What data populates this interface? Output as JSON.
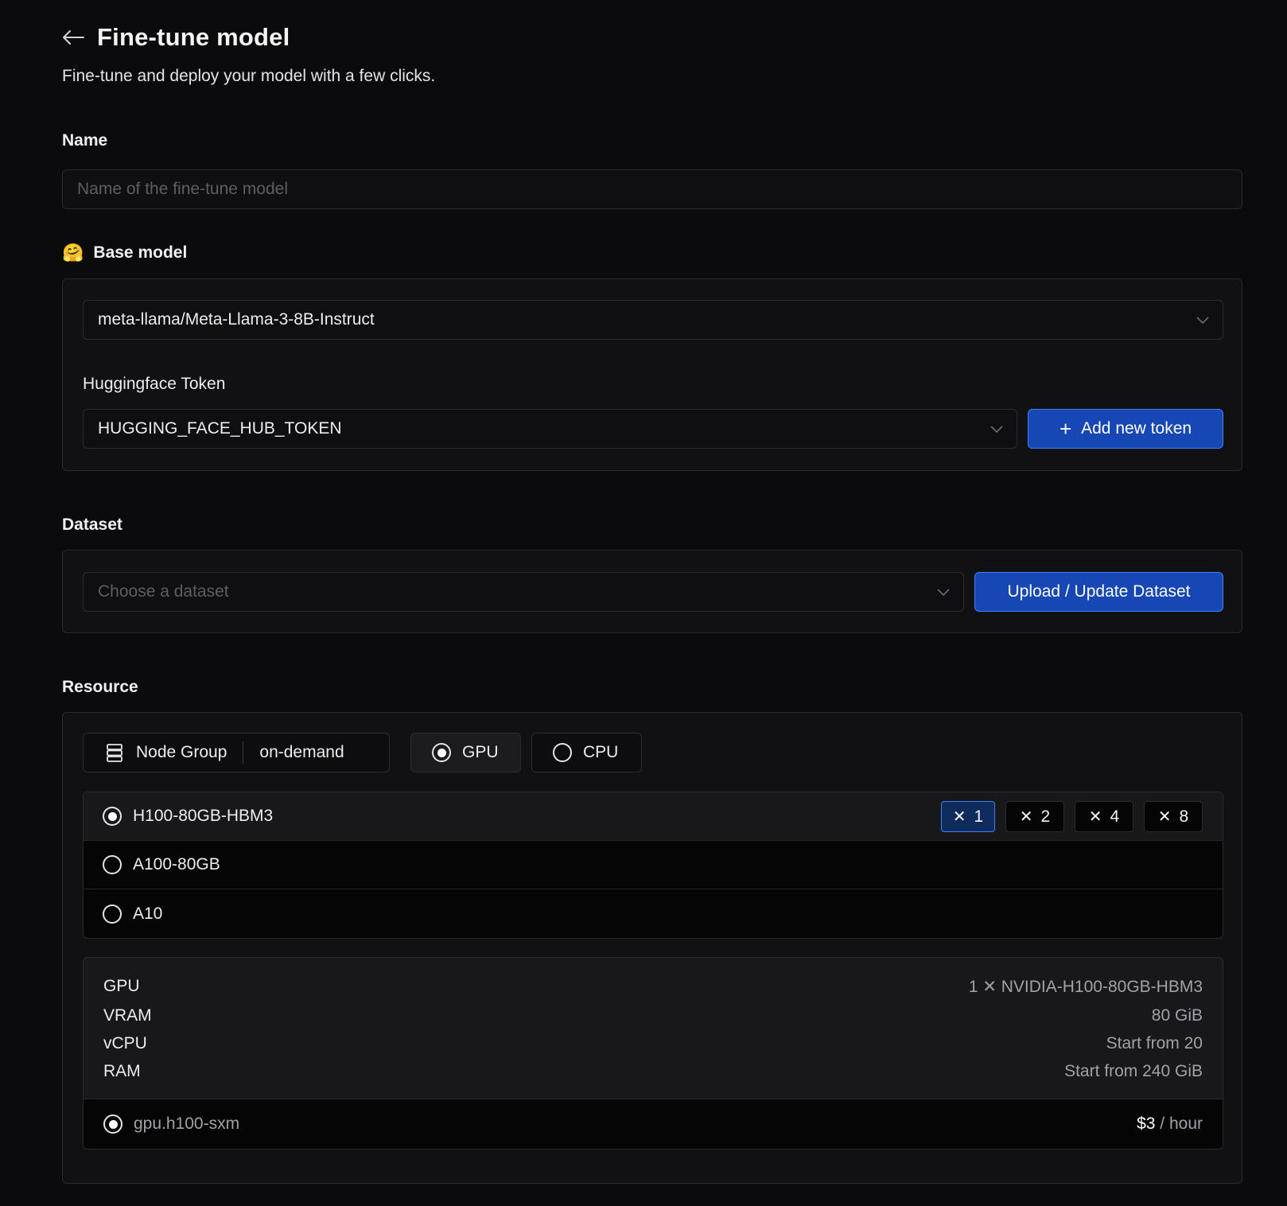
{
  "header": {
    "title": "Fine-tune model",
    "subtitle": "Fine-tune and deploy your model with a few clicks."
  },
  "name_section": {
    "label": "Name",
    "placeholder": "Name of the fine-tune model",
    "value": ""
  },
  "base_model": {
    "emoji": "🤗",
    "label": "Base model",
    "selected_model": "meta-llama/Meta-Llama-3-8B-Instruct",
    "token_label": "Huggingface Token",
    "selected_token": "HUGGING_FACE_HUB_TOKEN",
    "add_token_label": "Add new token"
  },
  "dataset": {
    "label": "Dataset",
    "placeholder": "Choose a dataset",
    "upload_label": "Upload / Update Dataset"
  },
  "resource": {
    "label": "Resource",
    "node_group_label": "Node Group",
    "node_group_value": "on-demand",
    "compute_types": [
      {
        "label": "GPU",
        "selected": true
      },
      {
        "label": "CPU",
        "selected": false
      }
    ],
    "gpus": [
      {
        "name": "H100-80GB-HBM3",
        "selected": true
      },
      {
        "name": "A100-80GB",
        "selected": false
      },
      {
        "name": "A10",
        "selected": false
      }
    ],
    "multipliers": [
      {
        "symbol": "✕",
        "count": "1",
        "selected": true
      },
      {
        "symbol": "✕",
        "count": "2",
        "selected": false
      },
      {
        "symbol": "✕",
        "count": "4",
        "selected": false
      },
      {
        "symbol": "✕",
        "count": "8",
        "selected": false
      }
    ],
    "spec": [
      {
        "key": "GPU",
        "value": "1 ✕ NVIDIA-H100-80GB-HBM3"
      },
      {
        "key": "VRAM",
        "value": "80 GiB"
      },
      {
        "key": "vCPU",
        "value": "Start from 20"
      },
      {
        "key": "RAM",
        "value": "Start from 240 GiB"
      }
    ],
    "instance": {
      "name": "gpu.h100-sxm",
      "price": "$3",
      "unit": " / hour"
    }
  }
}
